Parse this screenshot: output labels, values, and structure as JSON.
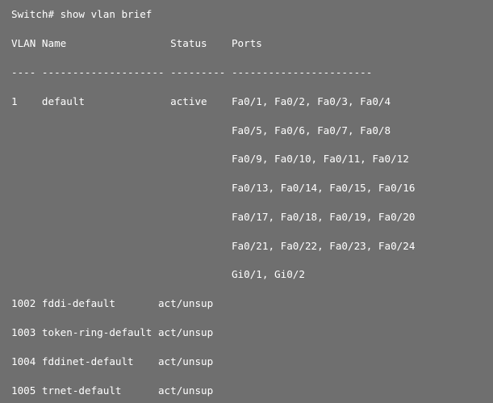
{
  "terminal": {
    "background": "#6f6f6f",
    "text_color": "#ffffff",
    "command": "Switch# show vlan brief",
    "header": "VLAN Name                 Status    Ports",
    "separator": "---- -------------------- --------- -----------------------",
    "rows": [
      "1    default              active    Fa0/1, Fa0/2, Fa0/3, Fa0/4",
      "                                    Fa0/5, Fa0/6, Fa0/7, Fa0/8",
      "                                    Fa0/9, Fa0/10, Fa0/11, Fa0/12",
      "                                    Fa0/13, Fa0/14, Fa0/15, Fa0/16",
      "                                    Fa0/17, Fa0/18, Fa0/19, Fa0/20",
      "                                    Fa0/21, Fa0/22, Fa0/23, Fa0/24",
      "                                    Gi0/1, Gi0/2",
      "1002 fddi-default       act/unsup",
      "1003 token-ring-default act/unsup",
      "1004 fddinet-default    act/unsup",
      "1005 trnet-default      act/unsup"
    ]
  }
}
